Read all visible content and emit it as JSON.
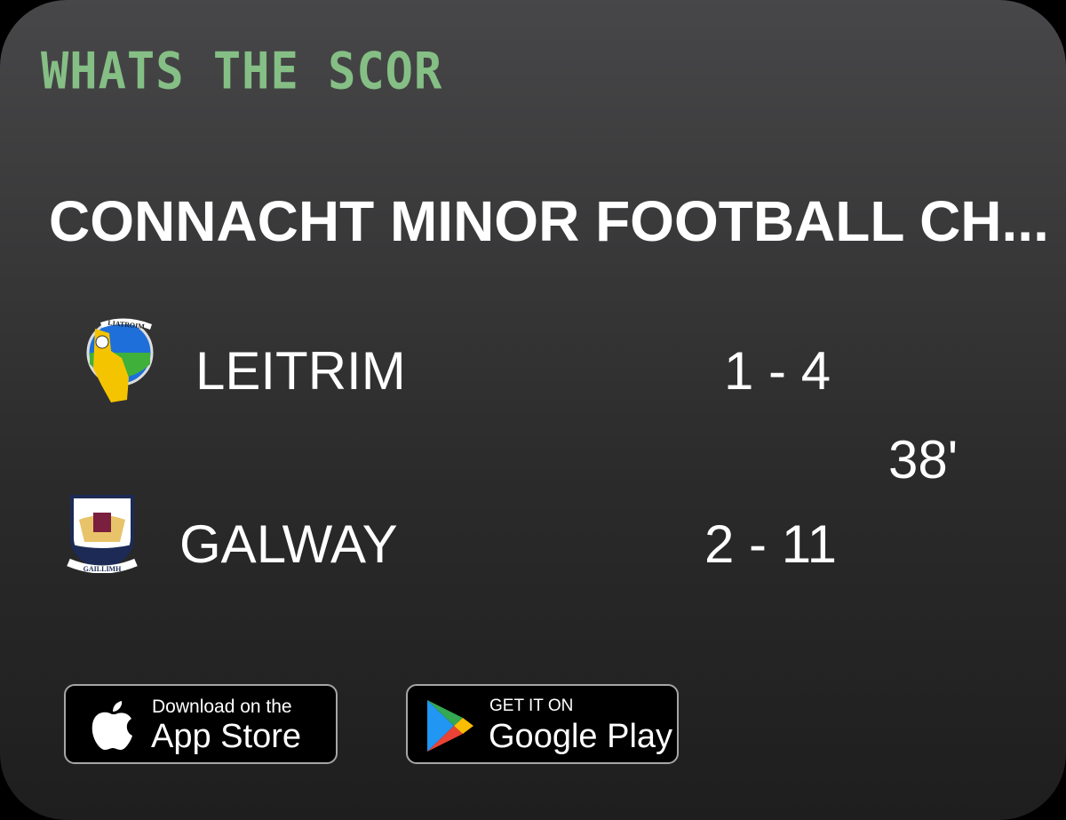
{
  "brand": {
    "logo_text": "WHATS THE SCOR",
    "color": "#85bf85"
  },
  "match": {
    "competition": "CONNACHT MINOR FOOTBALL CH...",
    "time": "38'",
    "home": {
      "name": "LEITRIM",
      "score": "1 - 4",
      "crest_text": "LIATROIM"
    },
    "away": {
      "name": "GALWAY",
      "score": "2 - 11",
      "crest_text": "GAILLIMH"
    }
  },
  "stores": {
    "apple": {
      "small": "Download on the",
      "big": "App Store",
      "icon": "apple-icon"
    },
    "google": {
      "small": "GET IT ON",
      "big": "Google Play",
      "icon": "google-play-icon"
    }
  }
}
